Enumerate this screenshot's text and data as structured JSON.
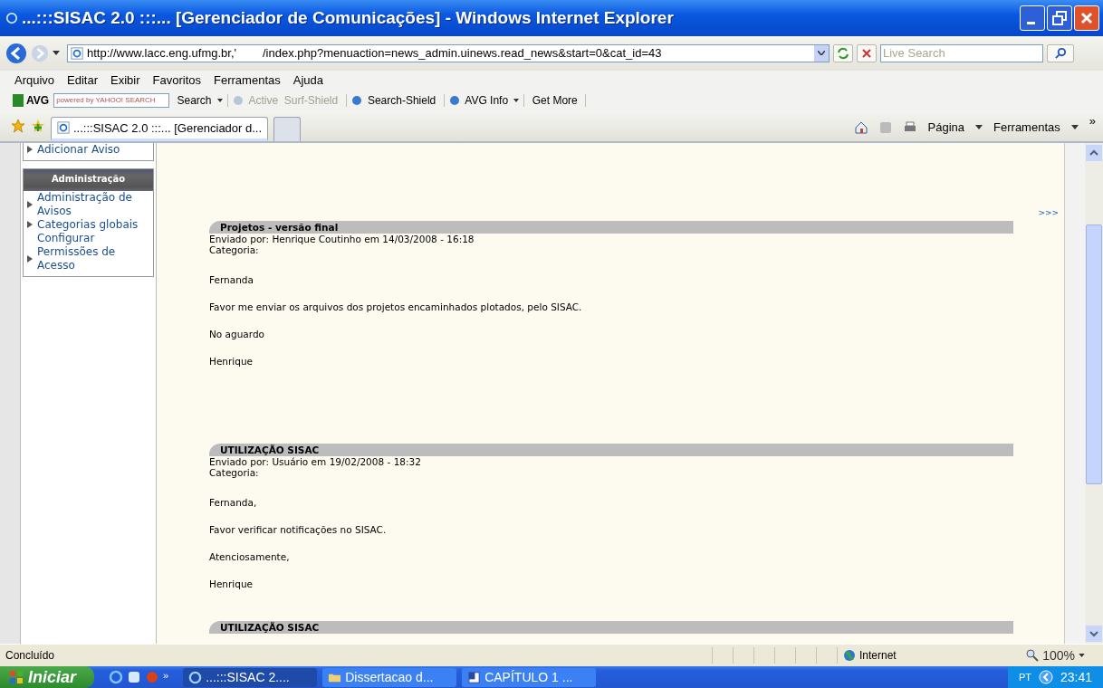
{
  "window": {
    "title": "...:::SISAC 2.0 :::... [Gerenciador de Comunicações] - Windows Internet Explorer"
  },
  "address": {
    "url": "http://www.lacc.eng.ufmg.br,'        /index.php?menuaction=news_admin.uinews.read_news&start=0&cat_id=43"
  },
  "search": {
    "placeholder": "Live Search"
  },
  "menu": [
    "Arquivo",
    "Editar",
    "Exibir",
    "Favoritos",
    "Ferramentas",
    "Ajuda"
  ],
  "avg_toolbar": {
    "brand": "AVG",
    "search_placeholder": "powered by YAHOO! SEARCH",
    "items": [
      {
        "label": "Search",
        "disabled": false,
        "kind": "dropdown"
      },
      {
        "label": "Active  Surf-Shield",
        "disabled": true,
        "kind": "shield"
      },
      {
        "label": "Search-Shield",
        "disabled": false,
        "kind": "shield"
      },
      {
        "label": "AVG Info",
        "disabled": false,
        "kind": "info"
      },
      {
        "label": "Get More",
        "disabled": false,
        "kind": "plain"
      }
    ]
  },
  "tabs": [
    {
      "label": "...:::SISAC 2.0 :::... [Gerenciador d...",
      "selected": true
    },
    {
      "selected": false
    }
  ],
  "command_bar": [
    "Página",
    "Ferramentas",
    "»"
  ],
  "sidebar": {
    "top_items": [
      {
        "label": "Adicionar Aviso",
        "bullet": true
      }
    ],
    "section": {
      "title": "Administração",
      "items": [
        {
          "label": "Administração de Avisos",
          "bullet": true
        },
        {
          "label": "Categorias globais",
          "bullet": true
        },
        {
          "label": "Configurar",
          "bullet": false
        },
        {
          "label": "Permissões de Acesso",
          "bullet": true
        }
      ]
    }
  },
  "pager": ">>>",
  "posts": [
    {
      "title": "Projetos - versão final",
      "meta": "Enviado por: Henrique Coutinho em 14/03/2008 - 16:18",
      "category": "Categoria:",
      "paragraphs": [
        "Fernanda",
        "Favor me enviar os arquivos dos projetos encaminhados plotados, pelo SISAC.",
        "No aguardo",
        "Henrique"
      ]
    },
    {
      "title": "UTILIZAÇÃO SISAC",
      "meta": "Enviado por: Usuário em 19/02/2008 - 18:32",
      "category": "Categoria:",
      "paragraphs": [
        "Fernanda,",
        "Favor verificar notificações no SISAC.",
        "Atenciosamente,",
        "Henrique"
      ]
    },
    {
      "title": "UTILIZAÇÃO SISAC"
    }
  ],
  "status_bar": {
    "text": "Concluído",
    "zone": "Internet",
    "zoom": "100%"
  },
  "taskbar": {
    "start": "Iniciar",
    "quick_launch": "»",
    "tasks": [
      {
        "label": "...:::SISAC 2....",
        "kind": "browser",
        "selected": true
      },
      {
        "label": "Dissertacao d...",
        "kind": "folder",
        "selected": false
      },
      {
        "label": "CAPÍTULO 1 ...",
        "kind": "document",
        "selected": false
      }
    ],
    "language": "PT",
    "clock": "23:41"
  }
}
